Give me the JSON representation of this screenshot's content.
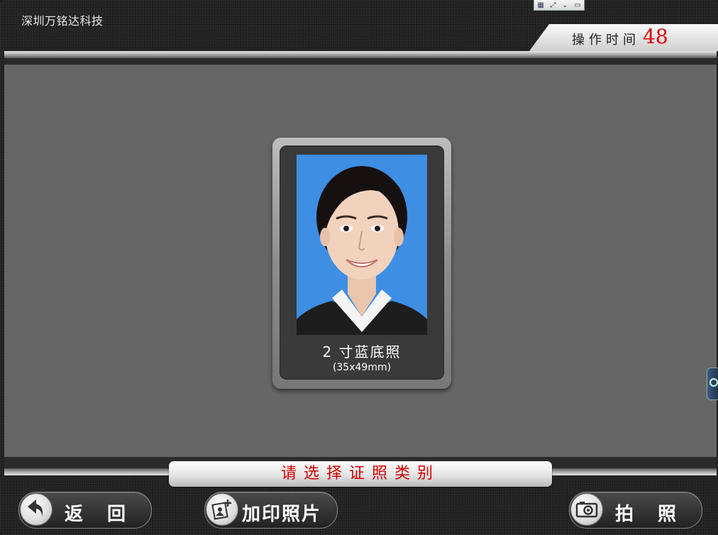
{
  "header": {
    "company_name": "深圳万铭达科技",
    "timer_label": "操作时间",
    "timer_value": "48"
  },
  "photo_card": {
    "title": "2 寸蓝底照",
    "subtitle": "(35x49mm)",
    "background_color": "#3e8ee3"
  },
  "prompt": {
    "text": "请选择证照类别",
    "color": "#d40000"
  },
  "buttons": {
    "back_label": "返回",
    "print_label": "加印照片",
    "shoot_label": "拍照"
  },
  "icons": {
    "back": "back-arrow-icon",
    "print": "add-print-photo-icon",
    "shoot": "camera-icon",
    "side": "side-panel-icon"
  }
}
